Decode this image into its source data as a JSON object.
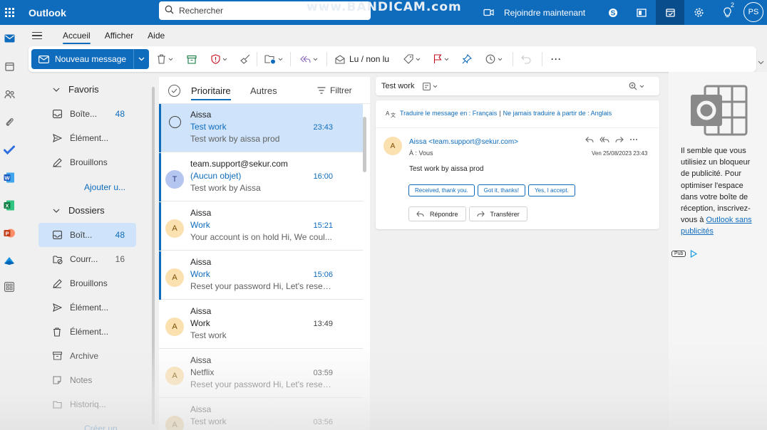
{
  "topbar": {
    "app_name": "Outlook",
    "search_placeholder": "Rechercher",
    "watermark": "www.BANDICAM.com",
    "join_label": "Rejoindre maintenant",
    "notif_count": "2",
    "user_initials": "PS",
    "brand_color": "#0f6cbd"
  },
  "menu": {
    "tabs": [
      "Accueil",
      "Afficher",
      "Aide"
    ]
  },
  "ribbon": {
    "new_message": "Nouveau message",
    "read_unread": "Lu / non lu",
    "more": "···"
  },
  "folders": {
    "favorites_label": "Favoris",
    "favorites": [
      {
        "label": "Boîte...",
        "count": "48"
      },
      {
        "label": "Élément..."
      },
      {
        "label": "Brouillons"
      }
    ],
    "add_favorite": "Ajouter u...",
    "folders_label": "Dossiers",
    "items": [
      {
        "label": "Boît...",
        "count": "48"
      },
      {
        "label": "Courr...",
        "count": "16"
      },
      {
        "label": "Brouillons"
      },
      {
        "label": "Élément..."
      },
      {
        "label": "Élément..."
      },
      {
        "label": "Archive"
      },
      {
        "label": "Notes"
      },
      {
        "label": "Historiq..."
      }
    ],
    "create_link": "Créer un..."
  },
  "list": {
    "tab_focused": "Prioritaire",
    "tab_other": "Autres",
    "filter": "Filtrer",
    "messages": [
      {
        "sender": "Aissa",
        "subject": "Test work",
        "time": "23:43",
        "preview": "Test work by aissa prod",
        "initial": "A",
        "unread": true,
        "selected": true
      },
      {
        "sender": "team.support@sekur.com",
        "subject": "(Aucun objet)",
        "time": "16:00",
        "preview": "Test work by Aissa",
        "initial": "T",
        "unread": true
      },
      {
        "sender": "Aissa",
        "subject": "Work",
        "time": "15:21",
        "preview": "Your account is on hold Hi, We coul...",
        "initial": "A",
        "unread": true
      },
      {
        "sender": "Aissa",
        "subject": "Work",
        "time": "15:06",
        "preview": "Reset your password Hi, Let's reset y...",
        "initial": "A",
        "unread": true
      },
      {
        "sender": "Aissa",
        "subject": "Work",
        "time": "13:49",
        "preview": "Test work",
        "initial": "A",
        "unread": false
      },
      {
        "sender": "Aissa",
        "subject": "Netflix",
        "time": "03:59",
        "preview": "Reset your password Hi, Let's reset y...",
        "initial": "A",
        "unread": false
      },
      {
        "sender": "Aissa",
        "subject": "Test work",
        "time": "03:56",
        "preview": "",
        "initial": "A",
        "unread": false
      }
    ]
  },
  "reading": {
    "title": "Test work",
    "translate_label": "Traduire le message en : Français",
    "translate_never": "Ne jamais traduire à partir de : Anglais",
    "sender_initial": "A",
    "from": "Aissa <team.support@sekur.com>",
    "to": "À : Vous",
    "date": "Ven 25/08/2023 23:43",
    "body": "Test work by aissa prod",
    "suggestions": [
      "Received, thank you.",
      "Got it, thanks!",
      "Yes, I accept."
    ],
    "reply": "Répondre",
    "forward": "Transférer"
  },
  "ad": {
    "text": "Il semble que vous utilisiez un bloqueur de publicité. Pour optimiser l'espace dans votre boîte de réception, inscrivez-vous à",
    "link": "Outlook sans publicités",
    "pub": "Pub"
  }
}
